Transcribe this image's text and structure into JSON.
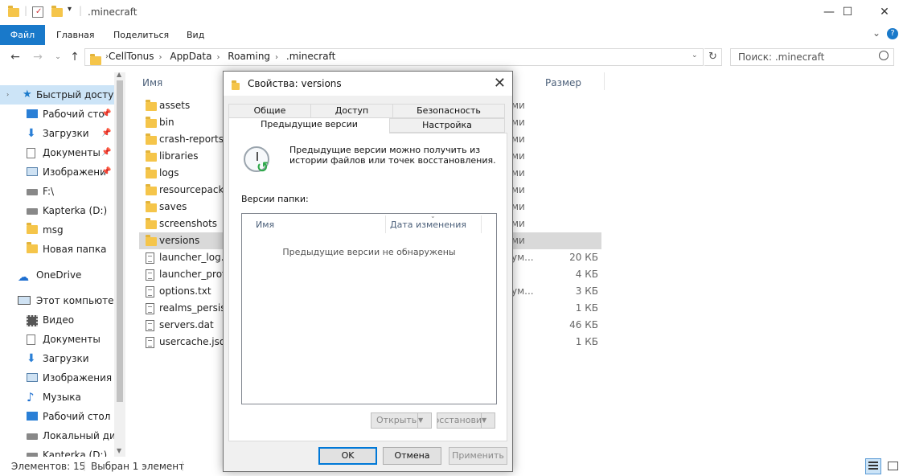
{
  "window": {
    "title": ".minecraft",
    "minimize_glyph": "—",
    "maximize_glyph": "☐",
    "close_glyph": "✕"
  },
  "ribbon": {
    "tabs": [
      "Файл",
      "Главная",
      "Поделиться",
      "Вид"
    ],
    "expand_glyph": "⌄",
    "help_glyph": "?"
  },
  "address": {
    "path": [
      "CellTonus",
      "AppData",
      "Roaming",
      ".minecraft"
    ],
    "search_placeholder": "Поиск: .minecraft"
  },
  "nav": {
    "quick_access": "Быстрый доступ",
    "items": [
      {
        "label": "Рабочий сто",
        "icon": "desktop-icon",
        "pinned": true
      },
      {
        "label": "Загрузки",
        "icon": "downloads-icon",
        "pinned": true
      },
      {
        "label": "Документы",
        "icon": "documents-icon",
        "pinned": true
      },
      {
        "label": "Изображени",
        "icon": "pictures-icon",
        "pinned": true
      },
      {
        "label": "F:\\",
        "icon": "drive-icon",
        "pinned": false
      },
      {
        "label": "Kapterka (D:)",
        "icon": "drive-icon",
        "pinned": false
      },
      {
        "label": "msg",
        "icon": "folder-icon",
        "pinned": false
      },
      {
        "label": "Новая папка",
        "icon": "folder-icon",
        "pinned": false
      }
    ],
    "onedrive": "OneDrive",
    "this_pc": "Этот компьютер",
    "pc_items": [
      {
        "label": "Видео",
        "icon": "video-icon"
      },
      {
        "label": "Документы",
        "icon": "documents-icon"
      },
      {
        "label": "Загрузки",
        "icon": "downloads-icon"
      },
      {
        "label": "Изображения",
        "icon": "pictures-icon"
      },
      {
        "label": "Музыка",
        "icon": "music-icon"
      },
      {
        "label": "Рабочий стол",
        "icon": "desktop-icon"
      },
      {
        "label": "Локальный дис",
        "icon": "drive-icon"
      },
      {
        "label": "Kapterka (D:)",
        "icon": "drive-icon"
      }
    ]
  },
  "filelist": {
    "col_name": "Имя",
    "col_size": "Размер",
    "rows": [
      {
        "name": "assets",
        "type": "ми",
        "size": "",
        "kind": "folder"
      },
      {
        "name": "bin",
        "type": "ми",
        "size": "",
        "kind": "folder"
      },
      {
        "name": "crash-reports",
        "type": "ми",
        "size": "",
        "kind": "folder"
      },
      {
        "name": "libraries",
        "type": "ми",
        "size": "",
        "kind": "folder"
      },
      {
        "name": "logs",
        "type": "ми",
        "size": "",
        "kind": "folder"
      },
      {
        "name": "resourcepacks",
        "type": "ми",
        "size": "",
        "kind": "folder"
      },
      {
        "name": "saves",
        "type": "ми",
        "size": "",
        "kind": "folder"
      },
      {
        "name": "screenshots",
        "type": "ми",
        "size": "",
        "kind": "folder"
      },
      {
        "name": "versions",
        "type": "ми",
        "size": "",
        "kind": "folder"
      },
      {
        "name": "launcher_log.tx",
        "type": "ум...",
        "size": "20 КБ",
        "kind": "file"
      },
      {
        "name": "launcher_profil",
        "type": "",
        "size": "4 КБ",
        "kind": "file"
      },
      {
        "name": "options.txt",
        "type": "ум...",
        "size": "3 КБ",
        "kind": "file"
      },
      {
        "name": "realms_persiste",
        "type": "",
        "size": "1 КБ",
        "kind": "file"
      },
      {
        "name": "servers.dat",
        "type": "",
        "size": "46 КБ",
        "kind": "file"
      },
      {
        "name": "usercache.json",
        "type": "",
        "size": "1 КБ",
        "kind": "file"
      }
    ]
  },
  "status": {
    "count": "Элементов: 15",
    "selected": "Выбран 1 элемент"
  },
  "dialog": {
    "title": "Свойства: versions",
    "tabs_back": [
      "Общие",
      "Доступ",
      "Безопасность"
    ],
    "tabs_front": [
      "Предыдущие версии",
      "Настройка"
    ],
    "description": "Предыдущие версии можно получить из истории файлов или точек восстановления.",
    "folder_versions_label": "Версии папки:",
    "col_name": "Имя",
    "col_date": "Дата изменения",
    "empty_message": "Предыдущие версии не обнаружены",
    "open_button": "Открыть",
    "restore_button": "Восстановить",
    "ok": "OK",
    "cancel": "Отмена",
    "apply": "Применить"
  }
}
